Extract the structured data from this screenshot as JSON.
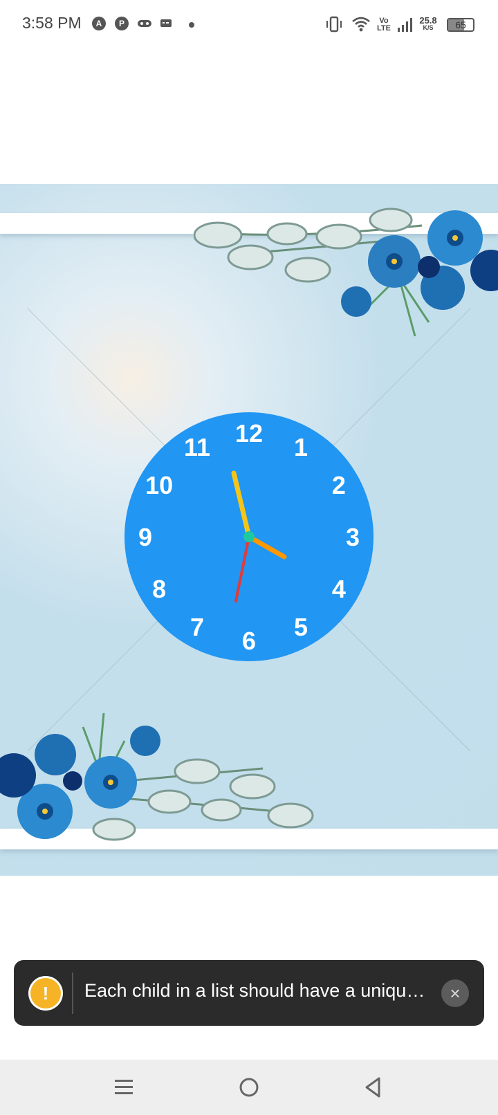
{
  "status_bar": {
    "time": "3:58 PM",
    "notification_icons": [
      "a-circle-icon",
      "pinterest-icon",
      "gamepad-icon",
      "message-icon",
      "dot-icon"
    ],
    "right_icons": [
      "vibrate-icon",
      "wifi-icon",
      "volte-icon",
      "signal-icon"
    ],
    "volte_label_top": "Vo",
    "volte_label_bottom": "LTE",
    "net_speed_value": "25.8",
    "net_speed_unit": "K/S",
    "battery_level": "65"
  },
  "clock": {
    "numbers": [
      "12",
      "1",
      "2",
      "3",
      "4",
      "5",
      "6",
      "7",
      "8",
      "9",
      "10",
      "11"
    ],
    "face_color": "#2196f3",
    "hour_hand_color": "#ff9800",
    "minute_hand_color": "#f5c518",
    "second_hand_color": "#e53935",
    "center_color": "#1ec8a0"
  },
  "toast": {
    "message": "Each child in a list should have a unique \"key\" prop.",
    "warning_icon": "!",
    "close_icon": "×"
  },
  "nav_bar": {
    "buttons": [
      "menu-icon",
      "home-icon",
      "back-icon"
    ]
  }
}
